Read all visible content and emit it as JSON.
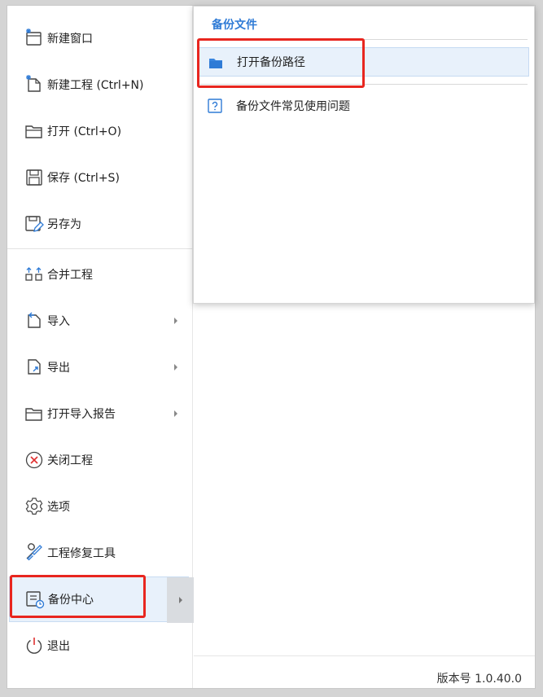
{
  "menu": {
    "items": [
      {
        "label": "新建窗口",
        "icon": "new-window-icon"
      },
      {
        "label": "新建工程 (Ctrl+N)",
        "icon": "new-project-icon"
      },
      {
        "label": "打开 (Ctrl+O)",
        "icon": "open-folder-icon"
      },
      {
        "label": "保存 (Ctrl+S)",
        "icon": "save-icon"
      },
      {
        "label": "另存为",
        "icon": "save-as-icon"
      },
      {
        "label": "合并工程",
        "icon": "merge-icon"
      },
      {
        "label": "导入",
        "icon": "import-icon"
      },
      {
        "label": "导出",
        "icon": "export-icon"
      },
      {
        "label": "打开导入报告",
        "icon": "open-report-icon"
      },
      {
        "label": "关闭工程",
        "icon": "close-circle-icon"
      },
      {
        "label": "选项",
        "icon": "gear-icon"
      },
      {
        "label": "工程修复工具",
        "icon": "repair-tools-icon"
      },
      {
        "label": "备份中心",
        "icon": "backup-center-icon"
      },
      {
        "label": "退出",
        "icon": "power-icon"
      }
    ]
  },
  "submenu": {
    "title": "备份文件",
    "items": [
      {
        "label": "打开备份路径",
        "icon": "folder-open-icon"
      },
      {
        "label": "备份文件常见使用问题",
        "icon": "help-icon"
      }
    ]
  },
  "footer": {
    "version": "版本号 1.0.40.0"
  },
  "colors": {
    "accent": "#2f7bd6",
    "highlight": "#e8261f",
    "active_bg": "#e8f1fb"
  }
}
